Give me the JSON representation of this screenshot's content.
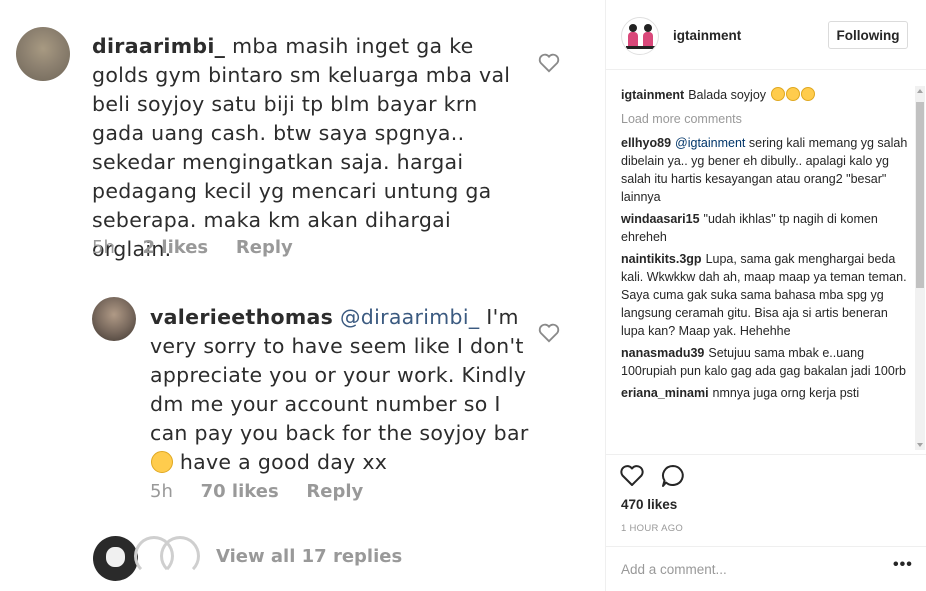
{
  "photo": {
    "comment1": {
      "username": "diraarimbi_",
      "text": "mba masih inget ga ke golds gym bintaro sm keluarga mba val beli soyjoy satu biji tp blm bayar krn gada uang cash. btw saya spgnya.. sekedar mengingatkan saja. hargai pedagang kecil yg mencari untung ga seberapa. maka km akan dihargai orglain.",
      "time": "5h",
      "likes": "2 likes",
      "reply": "Reply"
    },
    "comment2": {
      "username": "valerieethomas",
      "mention": "@diraarimbi_",
      "text": "I'm very sorry to have seem like I don't appreciate you or your work. Kindly dm me your account number so I can pay you back for the soyjoy bar",
      "text_end": "have a good day xx",
      "time": "5h",
      "likes": "70 likes",
      "reply": "Reply"
    },
    "view_replies": "View all 17 replies"
  },
  "sidebar": {
    "username": "igtainment",
    "follow_label": "Following",
    "caption": {
      "username": "igtainment",
      "text": "Balada soyjoy"
    },
    "load_more": "Load more comments",
    "comments": [
      {
        "username": "ellhyo89",
        "mention": "@igtainment",
        "text": "sering kali memang yg salah dibelain ya.. yg bener eh dibully.. apalagi kalo yg salah itu hartis kesayangan atau orang2 \"besar\" lainnya"
      },
      {
        "username": "windaasari15",
        "mention": "",
        "text": "\"udah ikhlas\" tp nagih di komen ehreheh"
      },
      {
        "username": "naintikits.3gp",
        "mention": "",
        "text": "Lupa, sama gak menghargai beda kali. Wkwkkw dah ah, maap maap ya teman teman. Saya cuma gak suka sama bahasa mba spg yg langsung ceramah gitu. Bisa aja si artis beneran lupa kan? Maap yak. Hehehhe"
      },
      {
        "username": "nanasmadu39",
        "mention": "",
        "text": "Setujuu sama mbak e..uang 100rupiah pun kalo gag ada gag bakalan jadi 100rb"
      },
      {
        "username": "eriana_minami",
        "mention": "",
        "text": "nmnya juga orng kerja psti"
      }
    ],
    "likes": "470 likes",
    "time": "1 HOUR AGO",
    "add_comment_placeholder": "Add a comment...",
    "more_label": "•••"
  },
  "icons": {
    "like": "heart-icon",
    "comment": "comment-bubble-icon",
    "more": "more-options-icon"
  }
}
